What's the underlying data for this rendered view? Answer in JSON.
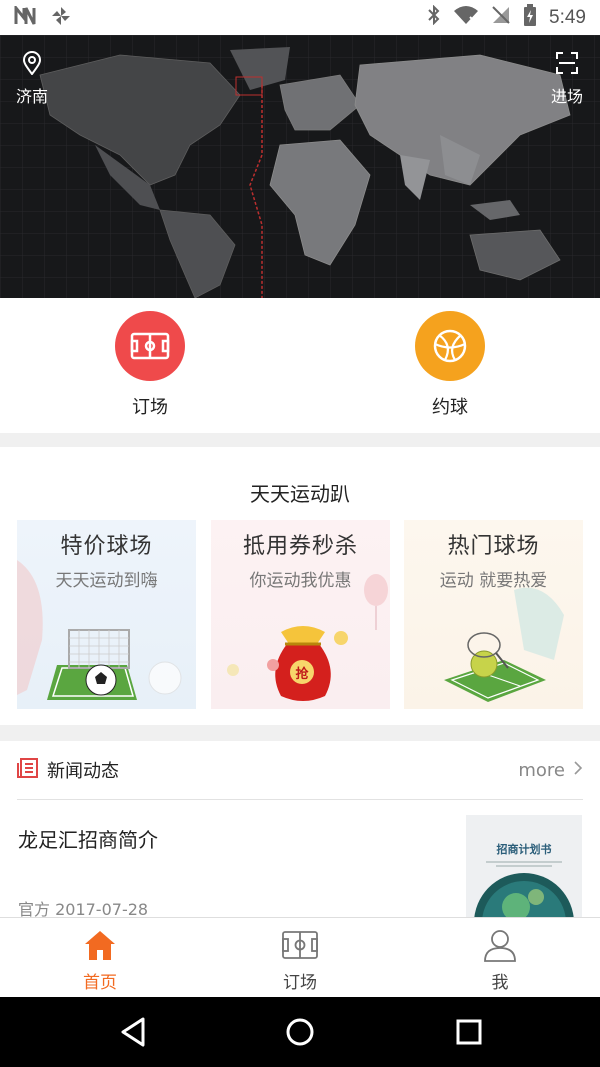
{
  "status_bar": {
    "time": "5:49"
  },
  "hero": {
    "location_label": "济南",
    "scan_label": "进场"
  },
  "quick_actions": [
    {
      "label": "订场",
      "color": "#ef4a4b",
      "icon": "soccer-field-icon"
    },
    {
      "label": "约球",
      "color": "#f5a21e",
      "icon": "basketball-icon"
    }
  ],
  "daily": {
    "title": "天天运动趴",
    "promos": [
      {
        "title": "特价球场",
        "subtitle": "天天运动到嗨"
      },
      {
        "title": "抵用券秒杀",
        "subtitle": "你运动我优惠",
        "badge": "抢"
      },
      {
        "title": "热门球场",
        "subtitle": "运动 就要热爱"
      }
    ]
  },
  "news": {
    "header_title": "新闻动态",
    "more_label": "more",
    "items": [
      {
        "title": "龙足汇招商简介",
        "meta": "官方 2017-07-28",
        "thumb_title": "招商计划书"
      }
    ]
  },
  "tabbar": {
    "tabs": [
      {
        "label": "首页",
        "active": true
      },
      {
        "label": "订场",
        "active": false
      },
      {
        "label": "我",
        "active": false
      }
    ],
    "active_color": "#f26a21"
  }
}
